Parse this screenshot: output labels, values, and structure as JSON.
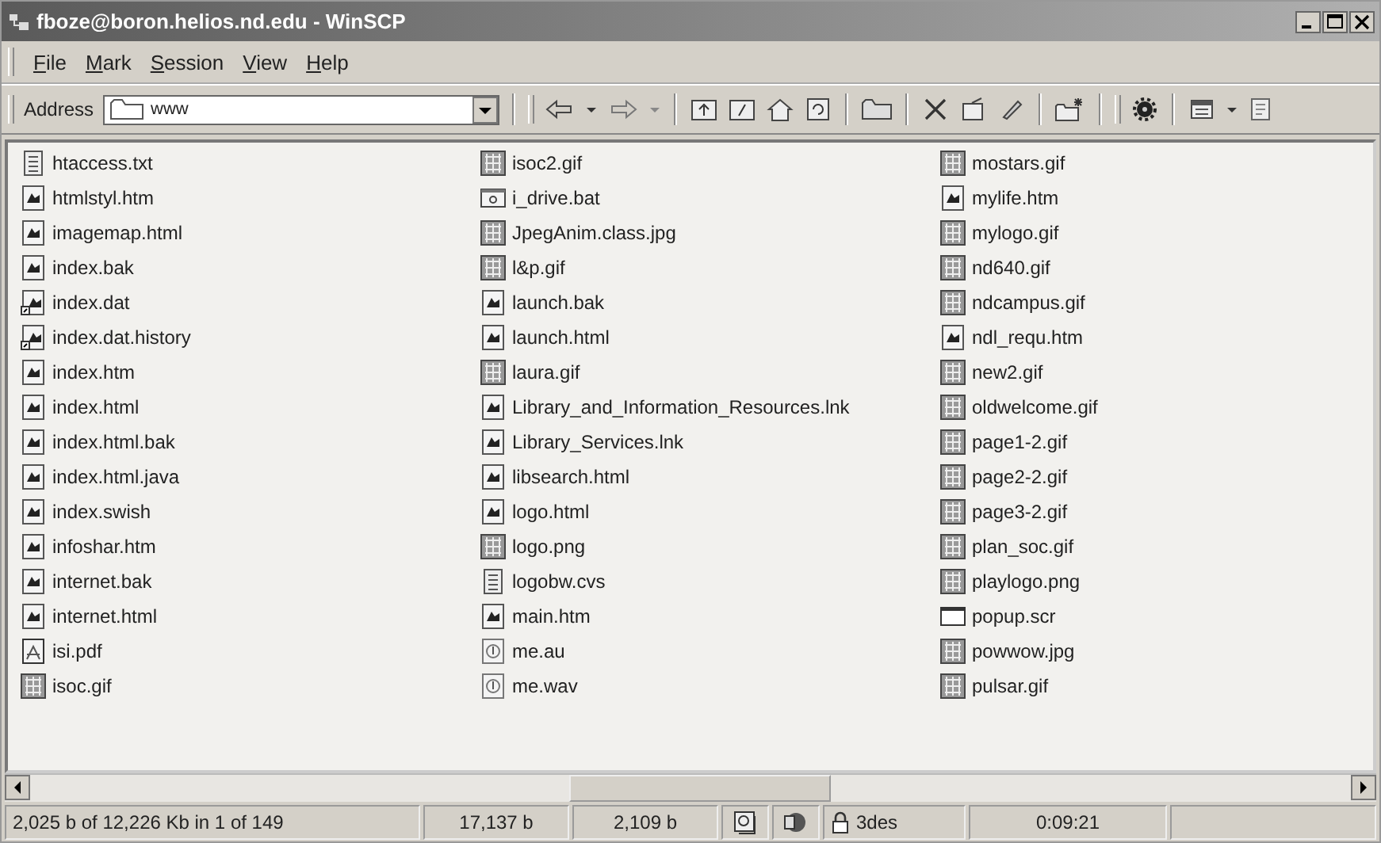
{
  "window": {
    "title": "fboze@boron.helios.nd.edu - WinSCP"
  },
  "menu": [
    "File",
    "Mark",
    "Session",
    "View",
    "Help"
  ],
  "address": {
    "label": "Address",
    "value": "www"
  },
  "files": [
    {
      "name": "htaccess.txt",
      "kind": "text"
    },
    {
      "name": "htmlstyl.htm",
      "kind": "html"
    },
    {
      "name": "imagemap.html",
      "kind": "html"
    },
    {
      "name": "index.bak",
      "kind": "html"
    },
    {
      "name": "index.dat",
      "kind": "link"
    },
    {
      "name": "index.dat.history",
      "kind": "link"
    },
    {
      "name": "index.htm",
      "kind": "html"
    },
    {
      "name": "index.html",
      "kind": "html"
    },
    {
      "name": "index.html.bak",
      "kind": "html"
    },
    {
      "name": "index.html.java",
      "kind": "html"
    },
    {
      "name": "index.swish",
      "kind": "html"
    },
    {
      "name": "infoshar.htm",
      "kind": "html"
    },
    {
      "name": "internet.bak",
      "kind": "html"
    },
    {
      "name": "internet.html",
      "kind": "html"
    },
    {
      "name": "isi.pdf",
      "kind": "pdf"
    },
    {
      "name": "isoc.gif",
      "kind": "image"
    },
    {
      "name": "isoc2.gif",
      "kind": "image"
    },
    {
      "name": "i_drive.bat",
      "kind": "batch"
    },
    {
      "name": "JpegAnim.class.jpg",
      "kind": "image"
    },
    {
      "name": "l&p.gif",
      "kind": "image"
    },
    {
      "name": "launch.bak",
      "kind": "html"
    },
    {
      "name": "launch.html",
      "kind": "html"
    },
    {
      "name": "laura.gif",
      "kind": "image"
    },
    {
      "name": "Library_and_Information_Resources.lnk",
      "kind": "html"
    },
    {
      "name": "Library_Services.lnk",
      "kind": "html"
    },
    {
      "name": "libsearch.html",
      "kind": "html"
    },
    {
      "name": "logo.html",
      "kind": "html"
    },
    {
      "name": "logo.png",
      "kind": "image"
    },
    {
      "name": "logobw.cvs",
      "kind": "text"
    },
    {
      "name": "main.htm",
      "kind": "html"
    },
    {
      "name": "me.au",
      "kind": "audio"
    },
    {
      "name": "me.wav",
      "kind": "audio"
    },
    {
      "name": "mostars.gif",
      "kind": "image"
    },
    {
      "name": "mylife.htm",
      "kind": "html"
    },
    {
      "name": "mylogo.gif",
      "kind": "image"
    },
    {
      "name": "nd640.gif",
      "kind": "image"
    },
    {
      "name": "ndcampus.gif",
      "kind": "image"
    },
    {
      "name": "ndl_requ.htm",
      "kind": "html"
    },
    {
      "name": "new2.gif",
      "kind": "image"
    },
    {
      "name": "oldwelcome.gif",
      "kind": "image"
    },
    {
      "name": "page1-2.gif",
      "kind": "image"
    },
    {
      "name": "page2-2.gif",
      "kind": "image"
    },
    {
      "name": "page3-2.gif",
      "kind": "image"
    },
    {
      "name": "plan_soc.gif",
      "kind": "image"
    },
    {
      "name": "playlogo.png",
      "kind": "image"
    },
    {
      "name": "popup.scr",
      "kind": "window"
    },
    {
      "name": "powwow.jpg",
      "kind": "image"
    },
    {
      "name": "pulsar.gif",
      "kind": "image"
    }
  ],
  "status_bar": {
    "selection": "2,025 b of 12,226 Kb in 1 of 149",
    "total_sent": "17,137 b",
    "total_received": "2,109 b",
    "cipher": "3des",
    "duration": "0:09:21"
  }
}
